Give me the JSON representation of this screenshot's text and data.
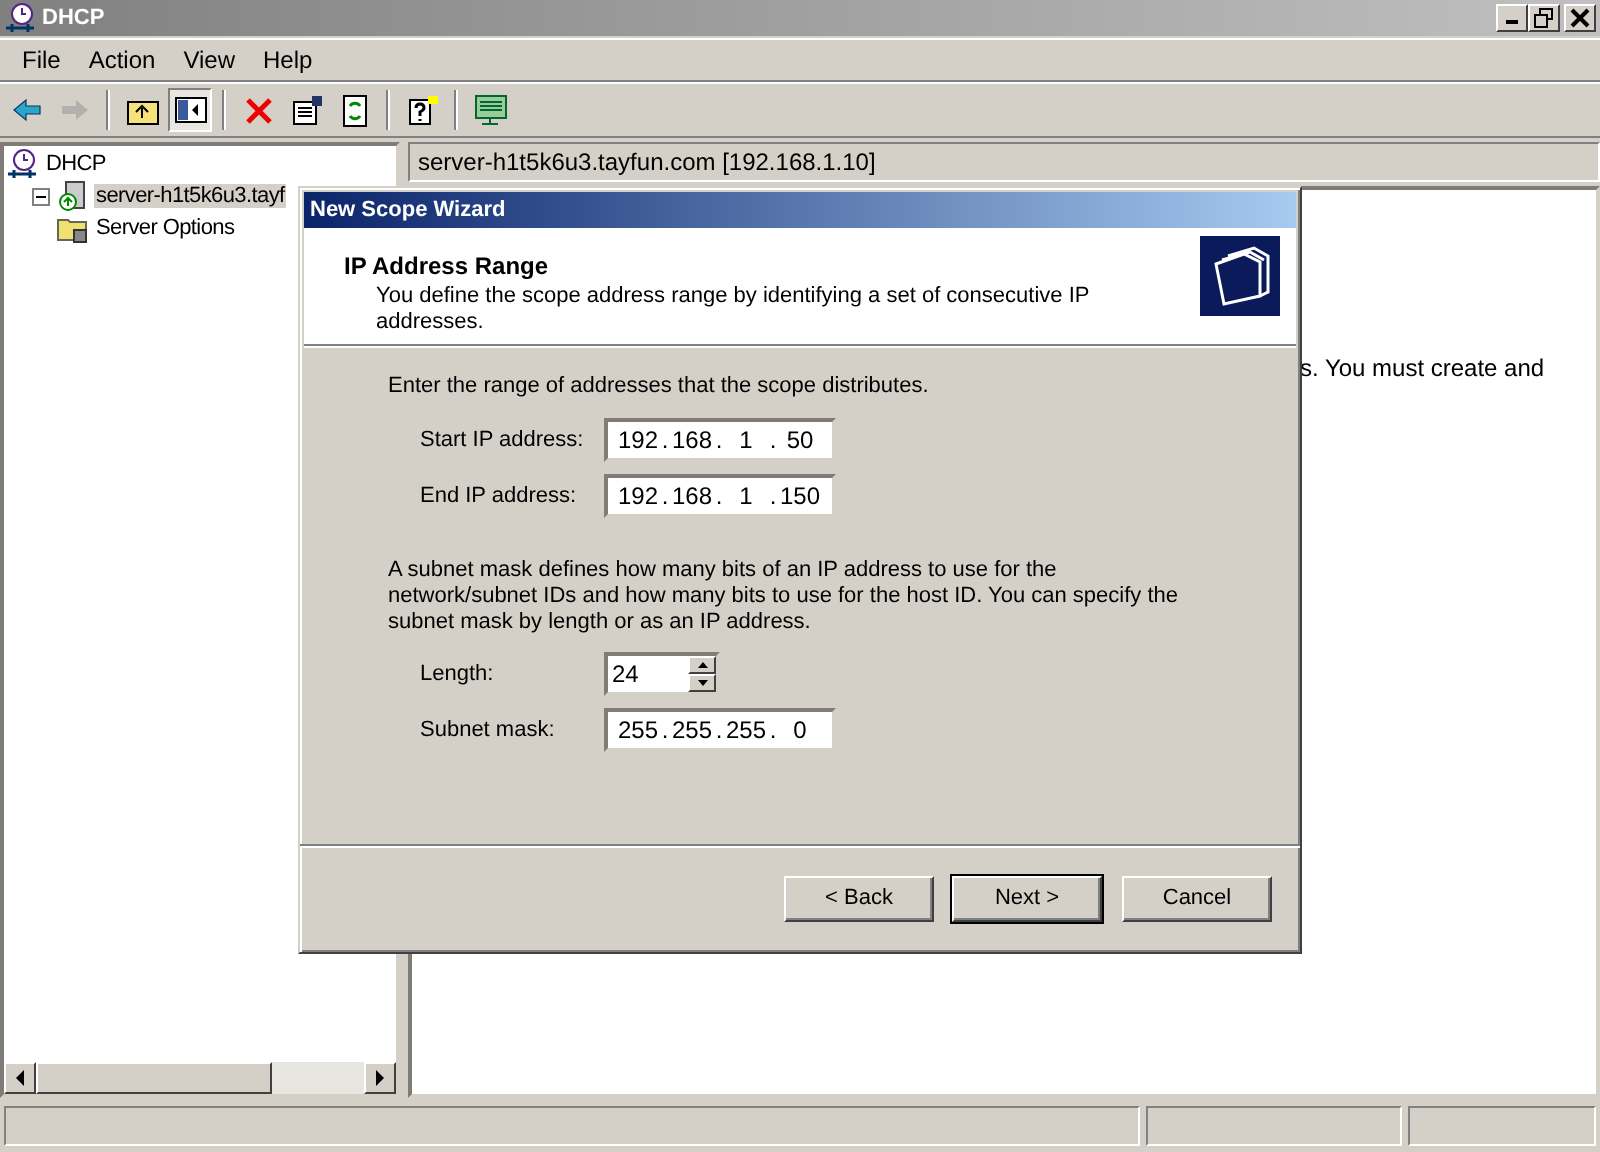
{
  "window": {
    "title": "DHCP"
  },
  "menu": [
    "File",
    "Action",
    "View",
    "Help"
  ],
  "toolbar": [
    {
      "kind": "back",
      "disabled": false,
      "pressed": false
    },
    {
      "kind": "forward",
      "disabled": true,
      "pressed": false
    },
    {
      "kind": "sep"
    },
    {
      "kind": "up",
      "disabled": false,
      "pressed": false
    },
    {
      "kind": "tree",
      "disabled": false,
      "pressed": true
    },
    {
      "kind": "sep"
    },
    {
      "kind": "delete",
      "disabled": false,
      "pressed": false
    },
    {
      "kind": "properties",
      "disabled": false,
      "pressed": false
    },
    {
      "kind": "refresh",
      "disabled": false,
      "pressed": false
    },
    {
      "kind": "sep"
    },
    {
      "kind": "help",
      "disabled": false,
      "pressed": false
    },
    {
      "kind": "sep"
    },
    {
      "kind": "monitor",
      "disabled": false,
      "pressed": false
    }
  ],
  "tree": [
    {
      "label": "DHCP",
      "kind": "root",
      "selected": false,
      "children": [
        {
          "label": "server-h1t5k6u3.tayf",
          "kind": "server",
          "selected": true,
          "expanded": true,
          "children": [
            {
              "label": "Server Options",
              "kind": "folder",
              "selected": false
            }
          ]
        }
      ]
    }
  ],
  "right_pane": {
    "header": "server-h1t5k6u3.tayfun.com [192.168.1.10]",
    "text": "s. You must create and"
  },
  "dialog": {
    "title": "New Scope Wizard",
    "heading": "IP Address Range",
    "subheading": "You define the scope address range by identifying a set of consecutive IP addresses.",
    "intro": "Enter the range of addresses that the scope distributes.",
    "octet_separator": ".",
    "range_fields": [
      {
        "label": "Start IP address:",
        "octets": [
          "192",
          "168",
          "1",
          "50"
        ]
      },
      {
        "label": "End IP address:",
        "octets": [
          "192",
          "168",
          "1",
          "150"
        ]
      }
    ],
    "mask_text": "A subnet mask defines how many bits of an IP address to use for the network/subnet IDs and how many bits to use for the host ID. You can specify the subnet mask by length or as an IP address.",
    "length": {
      "label": "Length:",
      "value": "24"
    },
    "subnet_mask": {
      "label": "Subnet mask:",
      "octets": [
        "255",
        "255",
        "255",
        "0"
      ]
    },
    "buttons": [
      {
        "label": "< Back",
        "default": false
      },
      {
        "label": "Next >",
        "default": true
      },
      {
        "label": "Cancel",
        "default": false
      }
    ]
  }
}
